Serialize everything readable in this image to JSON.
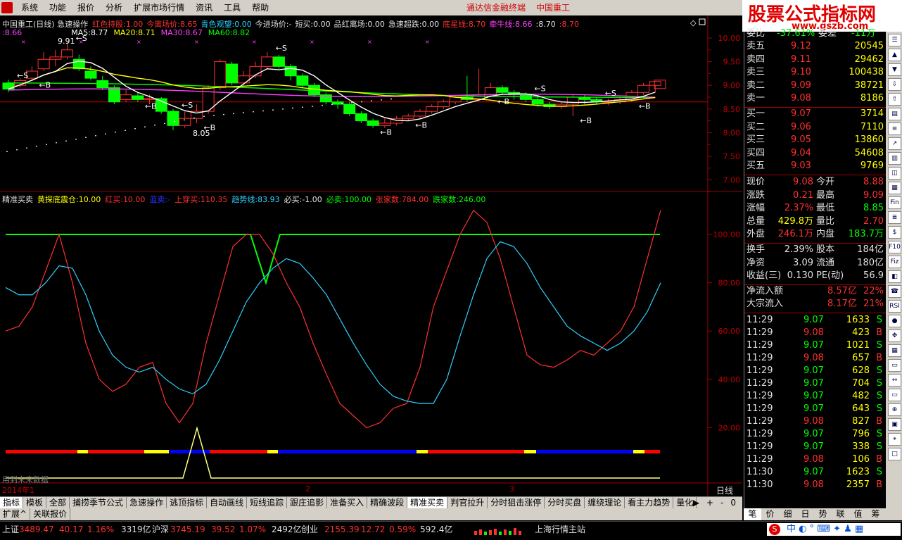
{
  "menu": {
    "items": [
      "系统",
      "功能",
      "报价",
      "分析",
      "扩展市场行情",
      "资讯",
      "工具",
      "帮助"
    ],
    "center_title": "通达信金融终端",
    "stock_name": "中国重工"
  },
  "logo": {
    "title": "股票公式指标网",
    "url": "www.gszb.com"
  },
  "main_legend": {
    "title": "中国重工(日线) 急速操作",
    "items": [
      {
        "label": "红色持股:",
        "value": "1.00",
        "color": "#ff3030"
      },
      {
        "label": "今离场价:",
        "value": "8.65",
        "color": "#ff3030"
      },
      {
        "label": "青色观望:",
        "value": "0.00",
        "color": "#30d0ff"
      },
      {
        "label": "今进场价:-",
        "value": "",
        "color": "#e0e0e0"
      },
      {
        "label": "短买:",
        "value": "0.00",
        "color": "#e0e0e0"
      },
      {
        "label": "品红离场:",
        "value": "0.00",
        "color": "#e0e0e0"
      },
      {
        "label": "急速超跌:",
        "value": "0.00",
        "color": "#e0e0e0"
      },
      {
        "label": "底星线:",
        "value": "8.70",
        "color": "#ff3030"
      },
      {
        "label": "牵牛线:",
        "value": "8.66",
        "color": "#ff40ff"
      },
      {
        "label": ":",
        "value": "8.70",
        "color": "#e0e0e0"
      },
      {
        "label": ":",
        "value": "8.70",
        "color": "#ff3030"
      }
    ],
    "row2_prefix": ":8.66",
    "ma": [
      {
        "label": "MA5:",
        "value": "8.77",
        "color": "#ffffff"
      },
      {
        "label": "MA20:",
        "value": "8.71",
        "color": "#ffff00"
      },
      {
        "label": "MA30:",
        "value": "8.67",
        "color": "#ff40ff"
      },
      {
        "label": "MA60:",
        "value": "8.82",
        "color": "#00ff00"
      }
    ]
  },
  "main_axis": {
    "ticks": [
      "10.00",
      "9.50",
      "9.00",
      "8.50",
      "8.00",
      "7.50",
      "7.00"
    ]
  },
  "main_annotations": {
    "high": "9.91",
    "low": "8.05",
    "sell_mark": "S",
    "buy_mark": "B"
  },
  "sub_legend": {
    "items": [
      {
        "label": "精准买卖",
        "value": "",
        "color": "#e0e0e0"
      },
      {
        "label": "黄探底震仓:",
        "value": "10.00",
        "color": "#ffff00"
      },
      {
        "label": "红买:",
        "value": "10.00",
        "color": "#ff3030"
      },
      {
        "label": "蓝卖:",
        "value": "-",
        "color": "#3030ff"
      },
      {
        "label": "上穿买:",
        "value": "110.35",
        "color": "#ff3030"
      },
      {
        "label": "趋势线:",
        "value": "83.93",
        "color": "#30d0ff"
      },
      {
        "label": "必买:",
        "value": "-1.00",
        "color": "#e0e0e0"
      },
      {
        "label": "必卖:",
        "value": "100.00",
        "color": "#00ff00"
      },
      {
        "label": "张家数:",
        "value": "784.00",
        "color": "#ff3030"
      },
      {
        "label": "跌家数:",
        "value": "246.00",
        "color": "#00ff00"
      }
    ]
  },
  "sub_axis": {
    "ticks": [
      "100.00",
      "80.00",
      "60.00",
      "40.00",
      "20.00"
    ]
  },
  "sub_note": "用到未来数据",
  "x_axis": {
    "labels": [
      "2014年1",
      "2",
      "3"
    ],
    "period": "日线"
  },
  "quote": {
    "header": {
      "label": "委比",
      "value": "-37.61%",
      "label2": "委差",
      "value2": "-11万"
    },
    "asks": [
      {
        "label": "卖五",
        "price": "9.12",
        "vol": "20545"
      },
      {
        "label": "卖四",
        "price": "9.11",
        "vol": "29462"
      },
      {
        "label": "卖三",
        "price": "9.10",
        "vol": "100438"
      },
      {
        "label": "卖二",
        "price": "9.09",
        "vol": "38721"
      },
      {
        "label": "卖一",
        "price": "9.08",
        "vol": "8186"
      }
    ],
    "bids": [
      {
        "label": "买一",
        "price": "9.07",
        "vol": "3714"
      },
      {
        "label": "买二",
        "price": "9.06",
        "vol": "7110"
      },
      {
        "label": "买三",
        "price": "9.05",
        "vol": "13860"
      },
      {
        "label": "买四",
        "price": "9.04",
        "vol": "54608"
      },
      {
        "label": "买五",
        "price": "9.03",
        "vol": "9769"
      }
    ],
    "stats": [
      {
        "l1": "现价",
        "v1": "9.08",
        "c1": "#ff3030",
        "l2": "今开",
        "v2": "8.88",
        "c2": "#ff3030"
      },
      {
        "l1": "涨跌",
        "v1": "0.21",
        "c1": "#ff3030",
        "l2": "最高",
        "v2": "9.09",
        "c2": "#ff3030"
      },
      {
        "l1": "涨幅",
        "v1": "2.37%",
        "c1": "#ff3030",
        "l2": "最低",
        "v2": "8.85",
        "c2": "#00ff00"
      },
      {
        "l1": "总量",
        "v1": "429.8万",
        "c1": "#ffff00",
        "l2": "量比",
        "v2": "2.70",
        "c2": "#ff3030"
      },
      {
        "l1": "外盘",
        "v1": "246.1万",
        "c1": "#ff3030",
        "l2": "内盘",
        "v2": "183.7万",
        "c2": "#00ff00"
      }
    ],
    "stats2": [
      {
        "l1": "换手",
        "v1": "2.39%",
        "l2": "股本",
        "v2": "184亿"
      },
      {
        "l1": "净资",
        "v1": "3.09",
        "l2": "流通",
        "v2": "180亿"
      },
      {
        "l1": "收益(三)",
        "v1": "0.130",
        "l2": "PE(动)",
        "v2": "56.9"
      }
    ],
    "flows": [
      {
        "label": "净流入额",
        "value": "8.57亿",
        "pct": "22%"
      },
      {
        "label": "大宗流入",
        "value": "8.17亿",
        "pct": "21%"
      }
    ],
    "ticks": [
      {
        "time": "11:29",
        "price": "9.07",
        "vol": "1633",
        "side": "S"
      },
      {
        "time": "11:29",
        "price": "9.08",
        "vol": "423",
        "side": "B"
      },
      {
        "time": "11:29",
        "price": "9.07",
        "vol": "1021",
        "side": "S"
      },
      {
        "time": "11:29",
        "price": "9.08",
        "vol": "657",
        "side": "B"
      },
      {
        "time": "11:29",
        "price": "9.07",
        "vol": "628",
        "side": "S"
      },
      {
        "time": "11:29",
        "price": "9.07",
        "vol": "704",
        "side": "S"
      },
      {
        "time": "11:29",
        "price": "9.07",
        "vol": "482",
        "side": "S"
      },
      {
        "time": "11:29",
        "price": "9.07",
        "vol": "643",
        "side": "S"
      },
      {
        "time": "11:29",
        "price": "9.08",
        "vol": "827",
        "side": "B"
      },
      {
        "time": "11:29",
        "price": "9.07",
        "vol": "796",
        "side": "S"
      },
      {
        "time": "11:29",
        "price": "9.07",
        "vol": "338",
        "side": "S"
      },
      {
        "time": "11:29",
        "price": "9.08",
        "vol": "106",
        "side": "B"
      },
      {
        "time": "11:30",
        "price": "9.07",
        "vol": "1623",
        "side": "S"
      },
      {
        "time": "11:30",
        "price": "9.08",
        "vol": "2357",
        "side": "B"
      }
    ]
  },
  "right_toolbar": [
    "☰",
    "▲",
    "▼",
    "⇩",
    "⇧",
    "▤",
    "≡",
    "↗",
    "▥",
    "◫",
    "▦",
    "Fin",
    "≣",
    "$",
    "F10",
    "Fiz",
    "◧",
    "☎",
    "RSI",
    "●",
    "✥",
    "▦",
    "▭",
    "↔",
    "▭",
    "⊕",
    "▣",
    "⌖",
    "□"
  ],
  "tabs": [
    "指标",
    "模板",
    "全部",
    "捕捞季节公式",
    "急速操作",
    "逃顶指标",
    "自动画线",
    "短线追踪",
    "跟庄追影",
    "准备买入",
    "精确波段",
    "精准买卖",
    "判官拉升",
    "分时狙击涨停",
    "分时买盘",
    "缠绕理论",
    "看主力趋势",
    "量化"
  ],
  "active_tab": "精准买卖",
  "tab_controls": [
    "▶",
    "+",
    "-",
    "0"
  ],
  "ext_tabs": [
    "扩展^",
    "关联报价"
  ],
  "right_tabs": [
    "笔",
    "价",
    "细",
    "日",
    "势",
    "联",
    "值",
    "筹"
  ],
  "status": {
    "sh_label": "上证",
    "sh_val": "3489.47",
    "sh_chg": "40.17",
    "sh_pct": "1.16%",
    "sh_amt": "3319亿",
    "sz_label": "沪深",
    "sz_val": "3745.19",
    "sz_chg": "39.52",
    "sz_pct": "1.07%",
    "sz_amt": "2492亿",
    "cy_label": "创业",
    "cy_val": "2155.39",
    "cy_chg": "12.72",
    "cy_pct": "0.59%",
    "cy_amt": "592.4亿",
    "site": "上海行情主站"
  },
  "colors": {
    "up": "#ff3030",
    "down": "#00ff00",
    "neutral": "#e0e0e0",
    "grid": "#a00000"
  }
}
